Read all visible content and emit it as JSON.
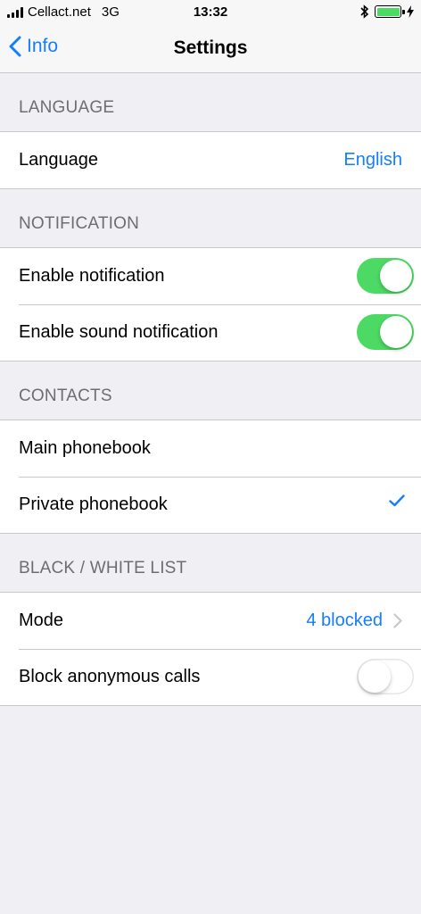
{
  "status_bar": {
    "carrier": "Cellact.net",
    "network": "3G",
    "time": "13:32"
  },
  "nav": {
    "back_label": "Info",
    "title": "Settings"
  },
  "sections": {
    "language": {
      "header": "LANGUAGE",
      "row_label": "Language",
      "row_value": "English"
    },
    "notification": {
      "header": "NOTIFICATION",
      "enable_label": "Enable notification",
      "enable_on": true,
      "sound_label": "Enable sound notification",
      "sound_on": true
    },
    "contacts": {
      "header": "CONTACTS",
      "main_label": "Main phonebook",
      "private_label": "Private phonebook",
      "selected": "Private phonebook"
    },
    "blacklist": {
      "header": "BLACK / WHITE LIST",
      "mode_label": "Mode",
      "mode_value": "4 blocked",
      "anon_label": "Block anonymous calls",
      "anon_on": false
    }
  },
  "colors": {
    "accent": "#157efb",
    "toggle_on": "#4cd964",
    "background": "#efeff4"
  },
  "icons": [
    "signal-icon",
    "bluetooth-icon",
    "battery-icon",
    "charging-icon",
    "back-chevron-icon",
    "checkmark-icon",
    "chevron-right-icon"
  ]
}
